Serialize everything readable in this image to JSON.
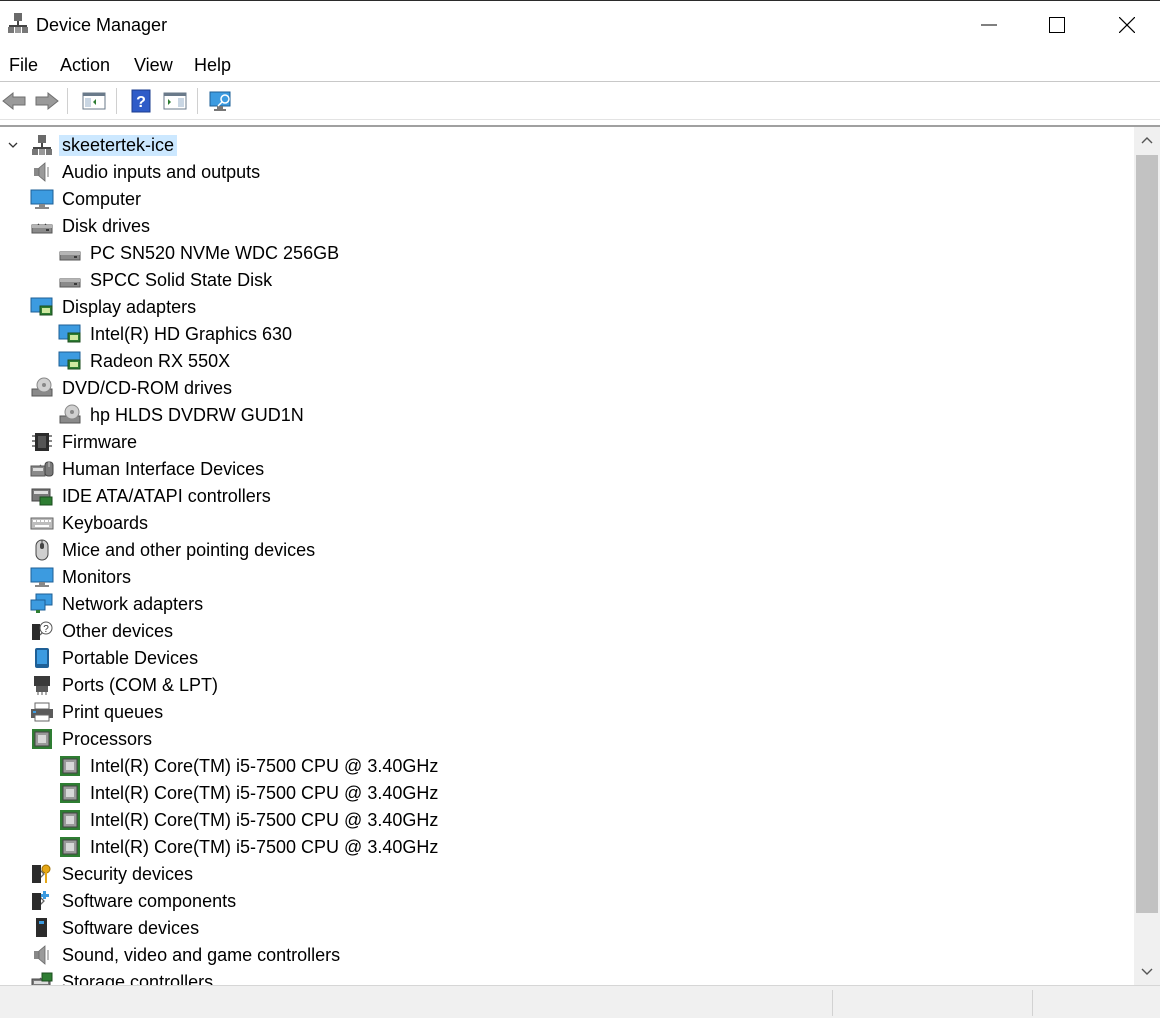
{
  "window": {
    "title": "Device Manager",
    "icon": "device-manager-icon",
    "controls": [
      "minimize-icon",
      "maximize-icon",
      "close-icon"
    ]
  },
  "menu": {
    "file": "File",
    "action": "Action",
    "view": "View",
    "help": "Help"
  },
  "toolbar": {
    "buttons": [
      "back-arrow-icon",
      "forward-arrow-icon",
      "show-hide-console-tree-icon",
      "help-icon",
      "properties-pane-icon",
      "scan-hardware-monitor-icon"
    ]
  },
  "tree": {
    "root": "skeetertek-ice",
    "rows": [
      {
        "label": "Audio inputs and outputs",
        "expanded": false,
        "icon": "speaker-icon"
      },
      {
        "label": "Computer",
        "expanded": false,
        "icon": "computer-icon"
      },
      {
        "label": "Disk drives",
        "expanded": true,
        "icon": "disk-drive-icon"
      },
      {
        "label": "PC SN520 NVMe WDC 256GB",
        "child": true,
        "icon": "disk-drive-icon"
      },
      {
        "label": "SPCC Solid State Disk",
        "child": true,
        "icon": "disk-drive-icon"
      },
      {
        "label": "Display adapters",
        "expanded": true,
        "icon": "display-adapter-icon"
      },
      {
        "label": "Intel(R) HD Graphics 630",
        "child": true,
        "icon": "display-adapter-icon"
      },
      {
        "label": "Radeon RX 550X",
        "child": true,
        "icon": "display-adapter-icon"
      },
      {
        "label": "DVD/CD-ROM drives",
        "expanded": true,
        "icon": "dvd-drive-icon"
      },
      {
        "label": "hp HLDS DVDRW  GUD1N",
        "child": true,
        "icon": "dvd-drive-icon"
      },
      {
        "label": "Firmware",
        "expanded": false,
        "icon": "firmware-chip-icon"
      },
      {
        "label": "Human Interface Devices",
        "expanded": false,
        "icon": "hid-icon"
      },
      {
        "label": "IDE ATA/ATAPI controllers",
        "expanded": false,
        "icon": "ide-controller-icon"
      },
      {
        "label": "Keyboards",
        "expanded": false,
        "icon": "keyboard-icon"
      },
      {
        "label": "Mice and other pointing devices",
        "expanded": false,
        "icon": "mouse-icon"
      },
      {
        "label": "Monitors",
        "expanded": false,
        "icon": "monitor-icon"
      },
      {
        "label": "Network adapters",
        "expanded": false,
        "icon": "network-adapter-icon"
      },
      {
        "label": "Other devices",
        "expanded": false,
        "icon": "unknown-device-icon"
      },
      {
        "label": "Portable Devices",
        "expanded": false,
        "icon": "portable-device-icon"
      },
      {
        "label": "Ports (COM & LPT)",
        "expanded": false,
        "icon": "port-icon"
      },
      {
        "label": "Print queues",
        "expanded": false,
        "icon": "printer-icon"
      },
      {
        "label": "Processors",
        "expanded": true,
        "icon": "processor-icon"
      },
      {
        "label": "Intel(R) Core(TM) i5-7500 CPU @ 3.40GHz",
        "child": true,
        "icon": "processor-icon"
      },
      {
        "label": "Intel(R) Core(TM) i5-7500 CPU @ 3.40GHz",
        "child": true,
        "icon": "processor-icon"
      },
      {
        "label": "Intel(R) Core(TM) i5-7500 CPU @ 3.40GHz",
        "child": true,
        "icon": "processor-icon"
      },
      {
        "label": "Intel(R) Core(TM) i5-7500 CPU @ 3.40GHz",
        "child": true,
        "icon": "processor-icon"
      },
      {
        "label": "Security devices",
        "expanded": false,
        "icon": "security-key-icon"
      },
      {
        "label": "Software components",
        "expanded": false,
        "icon": "software-component-icon"
      },
      {
        "label": "Software devices",
        "expanded": false,
        "icon": "software-device-icon"
      },
      {
        "label": "Sound, video and game controllers",
        "expanded": false,
        "icon": "speaker-icon"
      },
      {
        "label": "Storage controllers",
        "expanded": false,
        "icon": "storage-controller-icon"
      }
    ]
  },
  "colors": {
    "selection": "#cce8ff",
    "monitor_blue": "#3c9be0",
    "chip_green": "#2e7d32"
  }
}
